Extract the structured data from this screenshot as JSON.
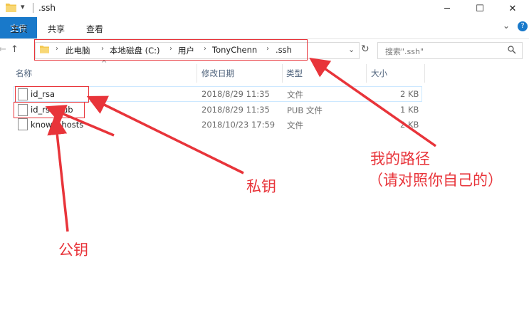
{
  "window": {
    "title": ".ssh",
    "quick_access": "▾",
    "min": "─",
    "max": "☐",
    "close": "✕"
  },
  "ribbon": {
    "tabs": [
      "文件",
      "主页",
      "共享",
      "查看"
    ],
    "expand": "⌄",
    "help": "?"
  },
  "nav": {
    "back": "←",
    "forward": "→",
    "dropdown": "⌄",
    "up": "↑",
    "breadcrumbs": [
      "此电脑",
      "本地磁盘 (C:)",
      "用户",
      "TonyChenn",
      ".ssh"
    ],
    "dropdown_history": "⌄",
    "refresh": "↻",
    "search_placeholder": "搜索\".ssh\"",
    "search_icon": "search-icon"
  },
  "columns": {
    "name": "名称",
    "modified": "修改日期",
    "type": "类型",
    "size": "大小",
    "sort_indicator": "^"
  },
  "files": [
    {
      "name": "id_rsa",
      "modified": "2018/8/29 11:35",
      "type": "文件",
      "size": "2 KB"
    },
    {
      "name": "id_rsa.pub",
      "modified": "2018/8/29 11:35",
      "type": "PUB 文件",
      "size": "1 KB"
    },
    {
      "name": "known_hosts",
      "modified": "2018/10/23 17:59",
      "type": "文件",
      "size": "2 KB"
    }
  ],
  "annotations": {
    "path_line1": "我的路径",
    "path_line2": "（请对照你自己的）",
    "private_key": "私钥",
    "public_key": "公钥",
    "color": "#e8343a"
  }
}
